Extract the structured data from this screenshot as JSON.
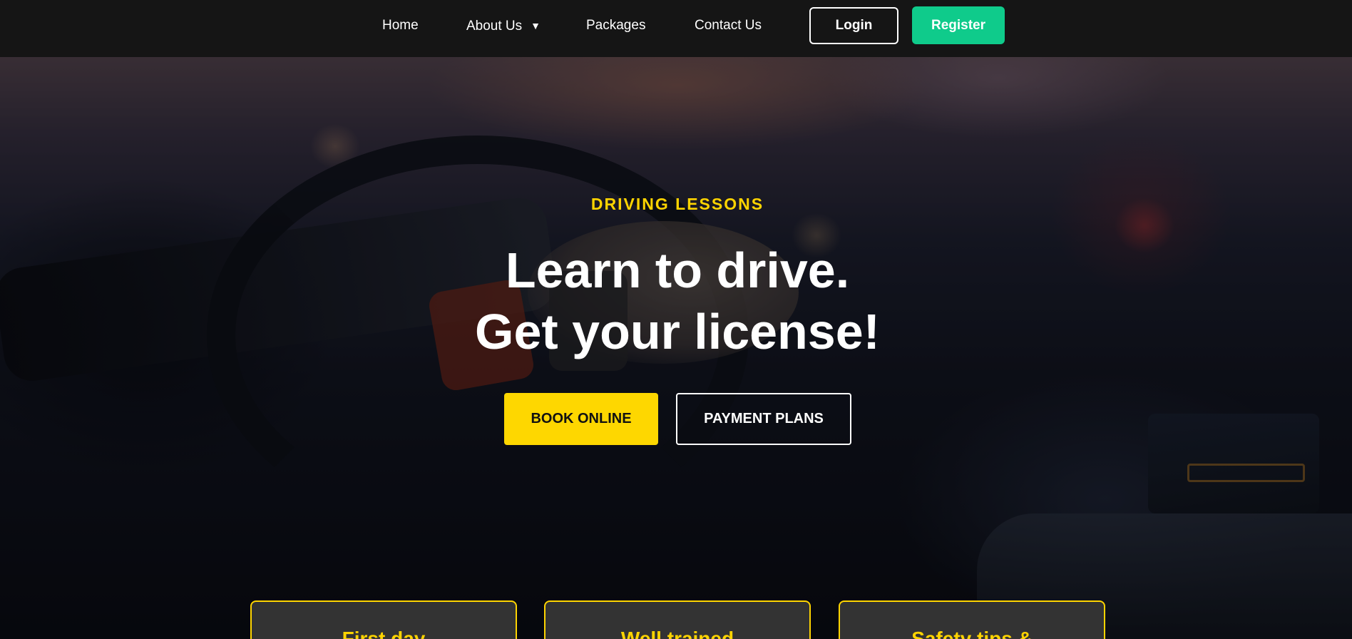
{
  "nav": {
    "links": [
      {
        "label": "Home"
      },
      {
        "label": "About Us",
        "caret": "▼"
      },
      {
        "label": "Packages"
      },
      {
        "label": "Contact Us"
      }
    ],
    "login_label": "Login",
    "register_label": "Register"
  },
  "hero": {
    "eyebrow": "DRIVING LESSONS",
    "headline_line1": "Learn to drive.",
    "headline_line2": "Get your license!",
    "book_label": "BOOK ONLINE",
    "payment_label": "PAYMENT PLANS"
  },
  "features": [
    {
      "title": "First day"
    },
    {
      "title": "Well trained"
    },
    {
      "title": "Safety tips &"
    }
  ],
  "colors": {
    "nav_bg": "#151515",
    "accent_yellow": "#fed400",
    "register_green": "#0fcb8b",
    "card_bg": "#333333"
  }
}
